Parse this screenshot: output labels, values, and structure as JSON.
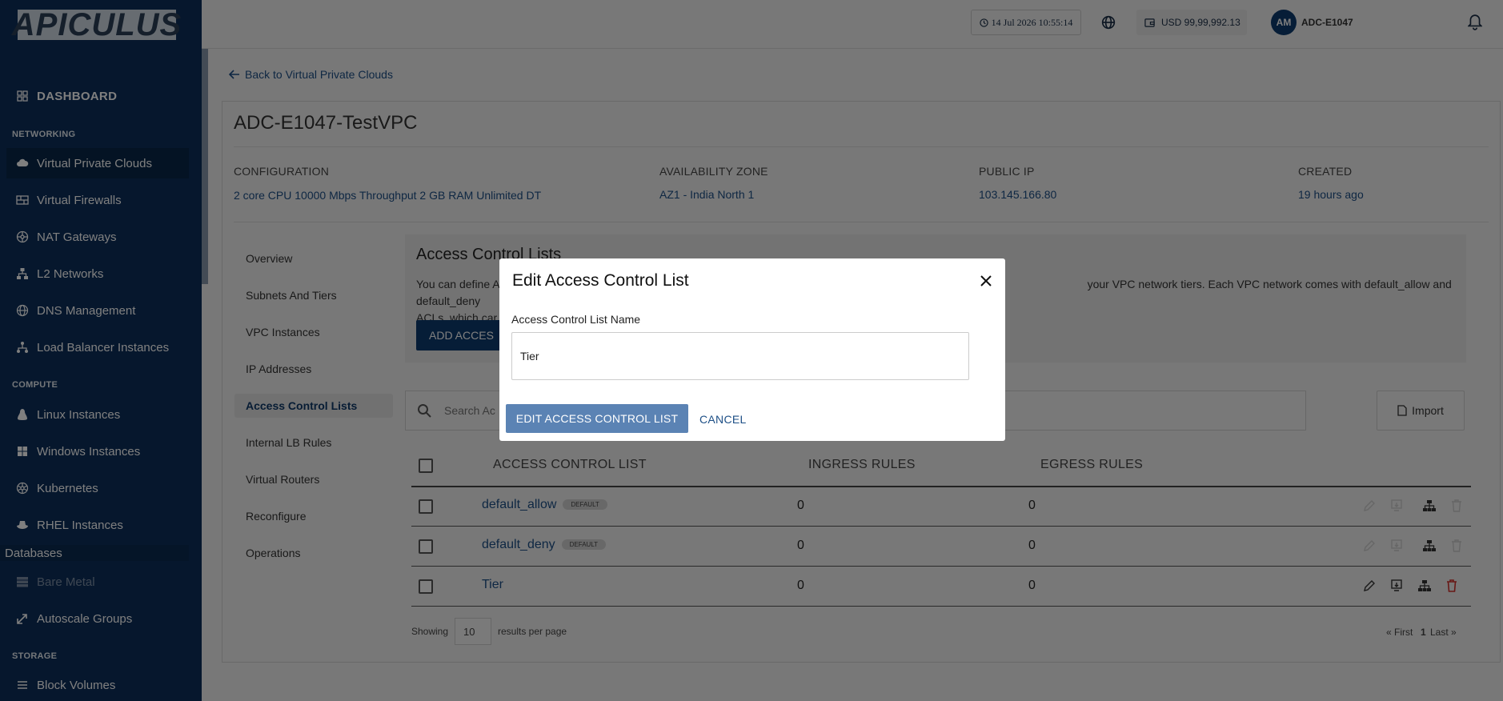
{
  "sidebar": {
    "logo": "APICULUS",
    "dashboard": "DASHBOARD",
    "sections": {
      "networking": "NETWORKING",
      "compute": "COMPUTE",
      "storage": "STORAGE"
    },
    "items": {
      "vpc": "Virtual Private Clouds",
      "firewalls": "Virtual Firewalls",
      "nat": "NAT Gateways",
      "l2": "L2 Networks",
      "dns": "DNS Management",
      "lb": "Load Balancer Instances",
      "linux": "Linux Instances",
      "windows": "Windows Instances",
      "kubernetes": "Kubernetes",
      "rhel": "RHEL Instances",
      "databases": "Databases",
      "baremetal": "Bare Metal",
      "autoscale": "Autoscale Groups",
      "block": "Block Volumes"
    }
  },
  "topbar": {
    "datetime": "14 Jul 2026 10:55:14",
    "balance": "USD 99,99,992.13",
    "avatar_initials": "AM",
    "account": "ADC-E1047"
  },
  "page": {
    "back": "Back to Virtual Private Clouds",
    "title": "ADC-E1047-TestVPC",
    "meta": [
      {
        "label": "CONFIGURATION",
        "value": "2 core CPU 10000 Mbps Throughput 2 GB RAM Unlimited DT"
      },
      {
        "label": "AVAILABILITY ZONE",
        "value": "AZ1 - India North 1"
      },
      {
        "label": "PUBLIC IP",
        "value": "103.145.166.80"
      },
      {
        "label": "CREATED",
        "value": "19 hours ago"
      }
    ],
    "tabs": [
      "Overview",
      "Subnets And Tiers",
      "VPC Instances",
      "IP Addresses",
      "Access Control Lists",
      "Internal LB Rules",
      "Virtual Routers",
      "Reconfigure",
      "Operations"
    ],
    "selected_tab": "Access Control Lists"
  },
  "acl": {
    "heading": "Access Control Lists",
    "desc_left": "You can define A",
    "desc_right": "your VPC network tiers. Each VPC network comes with default_allow and default_deny",
    "desc_line2": "ACLs, which car",
    "add_button": "ADD ACCES",
    "search_placeholder": "Search Ac",
    "import": "Import",
    "columns": [
      "ACCESS CONTROL LIST",
      "INGRESS RULES",
      "EGRESS RULES"
    ],
    "rows": [
      {
        "name": "default_allow",
        "badge": "DEFAULT",
        "ingress": "0",
        "egress": "0"
      },
      {
        "name": "default_deny",
        "badge": "DEFAULT",
        "ingress": "0",
        "egress": "0"
      },
      {
        "name": "Tier",
        "badge": "",
        "ingress": "0",
        "egress": "0"
      }
    ],
    "showing": "Showing",
    "per_page_value": "10",
    "per_page_label": "results per page",
    "pager": {
      "first": "« First",
      "current": "1",
      "last": "Last »"
    }
  },
  "modal": {
    "title": "Edit Access Control List",
    "field_label": "Access Control List Name",
    "field_value": "Tier",
    "submit": "EDIT ACCESS CONTROL LIST",
    "cancel": "CANCEL"
  },
  "colors": {
    "sidebar": "#0d2f5a",
    "primary": "#0c3a6e",
    "link": "#1d4f86",
    "danger": "#d0312d"
  }
}
